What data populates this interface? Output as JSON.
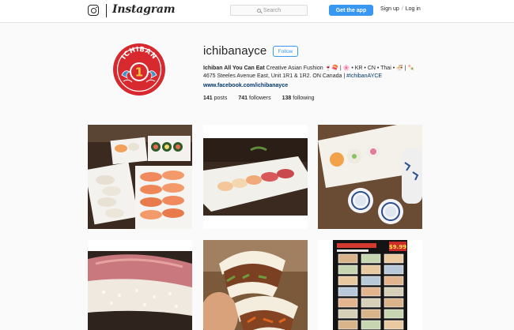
{
  "topbar": {
    "brand": "Instagram",
    "search_placeholder": "Search",
    "get_app_label": "Get the app",
    "signup_label": "Sign up",
    "separator": "/",
    "login_label": "Log in"
  },
  "profile": {
    "username": "ichibanayce",
    "follow_label": "Follow",
    "avatar_text": "ICHIBAN",
    "bio_name": "Ichiban All You Can Eat",
    "bio_tagline": "Creative Asian Fushion 🍷🍣 | 🌸 • KR • CN • Thai • 🍜 | 🍡",
    "bio_address": "4675 Steeles Avenue East, Unit 1R1 & 1R2. ON Canada |",
    "bio_hashtag": "#IchibanAYCE",
    "website": "www.facebook.com/ichibanayce"
  },
  "stats": {
    "posts_count": "141",
    "posts_label": "posts",
    "followers_count": "741",
    "followers_label": "followers",
    "following_count": "138",
    "following_label": "following"
  },
  "menu_poster": {
    "price": "$9.99"
  },
  "colors": {
    "accent": "#3897f0",
    "link": "#003569",
    "logo_red": "#d8292f"
  }
}
